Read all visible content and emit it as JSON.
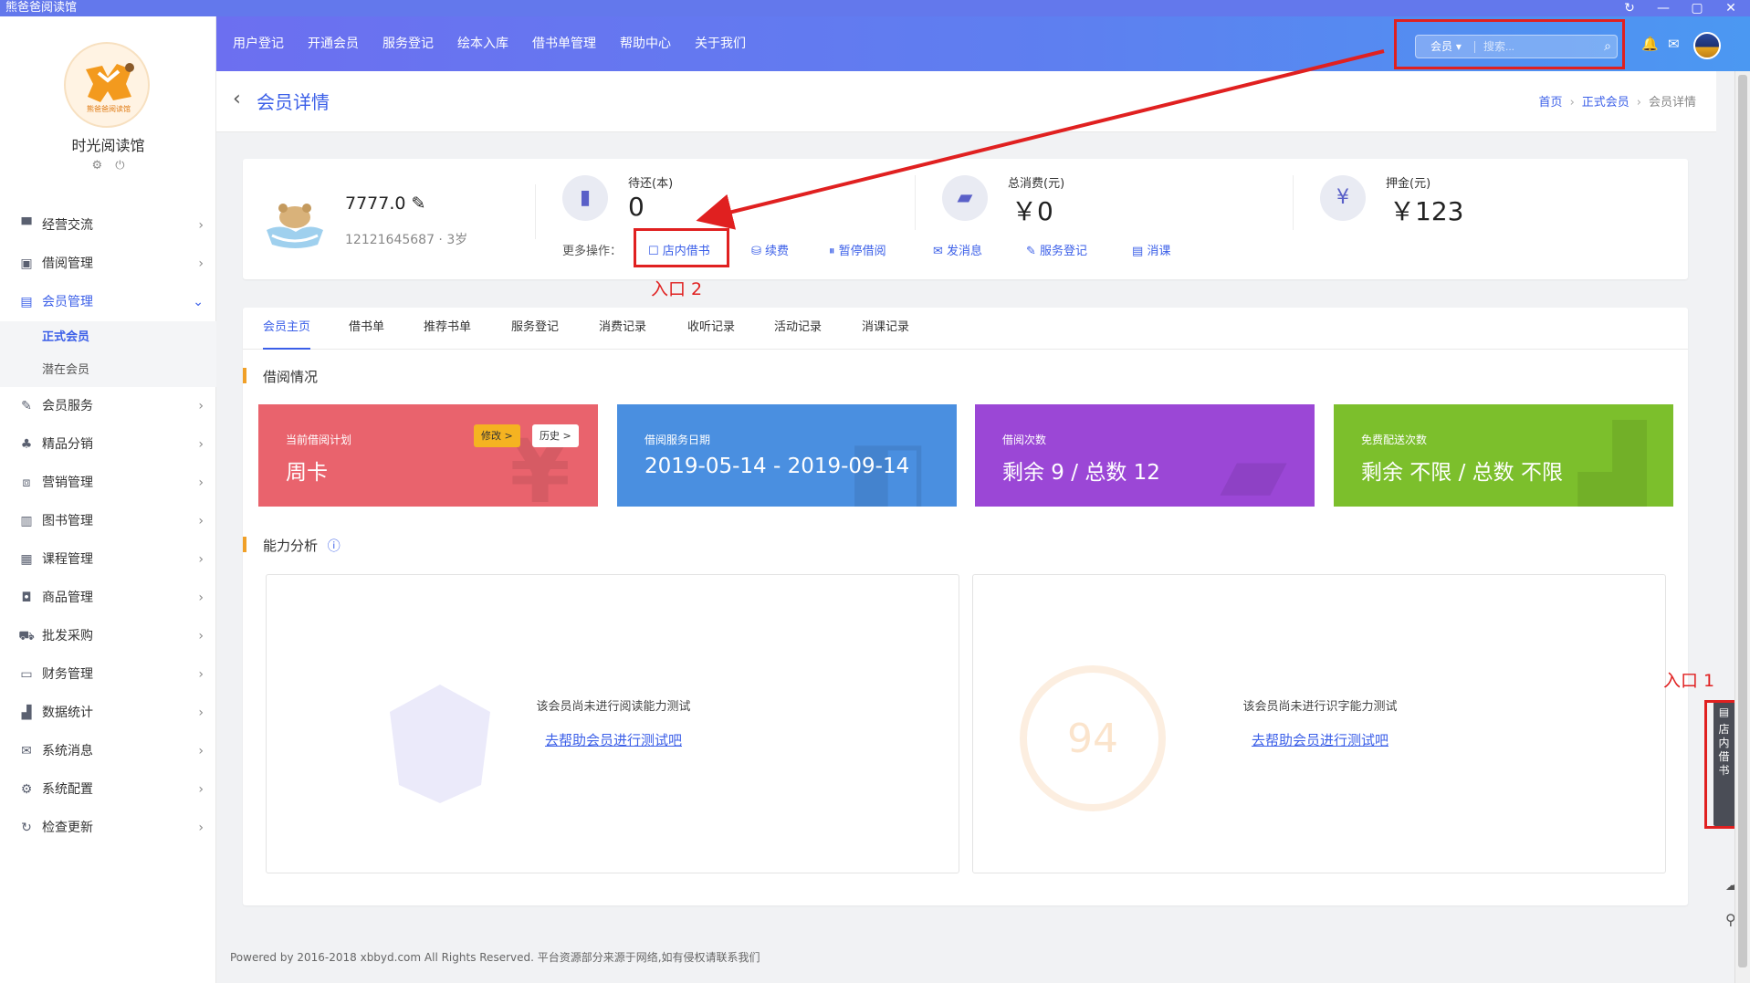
{
  "window": {
    "title": "熊爸爸阅读馆",
    "controls": [
      "↻",
      "—",
      "▢",
      "✕"
    ]
  },
  "sidebar": {
    "logo_text": "熊爸爸阅读馆",
    "shop_name": "时光阅读馆",
    "icons": [
      "gear-icon",
      "power-icon"
    ],
    "menu": [
      {
        "label": "经营交流",
        "icon": "chat-icon"
      },
      {
        "label": "借阅管理",
        "icon": "box-icon"
      },
      {
        "label": "会员管理",
        "icon": "member-icon",
        "active": true,
        "children": [
          {
            "label": "正式会员",
            "active": true
          },
          {
            "label": "潜在会员"
          }
        ]
      },
      {
        "label": "会员服务",
        "icon": "service-icon"
      },
      {
        "label": "精品分销",
        "icon": "network-icon"
      },
      {
        "label": "营销管理",
        "icon": "ticket-icon"
      },
      {
        "label": "图书管理",
        "icon": "book-icon"
      },
      {
        "label": "课程管理",
        "icon": "course-icon"
      },
      {
        "label": "商品管理",
        "icon": "bag-icon"
      },
      {
        "label": "批发采购",
        "icon": "cart-icon"
      },
      {
        "label": "财务管理",
        "icon": "finance-icon"
      },
      {
        "label": "数据统计",
        "icon": "chart-icon"
      },
      {
        "label": "系统消息",
        "icon": "mail-icon"
      },
      {
        "label": "系统配置",
        "icon": "gear-icon"
      },
      {
        "label": "检查更新",
        "icon": "refresh-icon"
      }
    ]
  },
  "topnav": {
    "links": [
      "用户登记",
      "开通会员",
      "服务登记",
      "绘本入库",
      "借书单管理",
      "帮助中心",
      "关于我们"
    ],
    "search_scope": "会员",
    "search_placeholder": "搜索..."
  },
  "header": {
    "title": "会员详情",
    "breadcrumb": [
      "首页",
      "正式会员",
      "会员详情"
    ]
  },
  "member": {
    "name": "7777.0",
    "sub": "12121645687 · 3岁",
    "stats": [
      {
        "label": "待还(本)",
        "value": "0",
        "icon": "book-icon"
      },
      {
        "label": "总消费(元)",
        "value": "￥0",
        "icon": "wallet-icon"
      },
      {
        "label": "押金(元)",
        "value": "￥123",
        "icon": "shield-yen-icon"
      }
    ],
    "ops_label": "更多操作：",
    "ops": [
      {
        "label": "店内借书",
        "icon": "☐"
      },
      {
        "label": "续费",
        "icon": "⛁"
      },
      {
        "label": "暂停借阅",
        "icon": "⏸"
      },
      {
        "label": "发消息",
        "icon": "✉"
      },
      {
        "label": "服务登记",
        "icon": "✎"
      },
      {
        "label": "消课",
        "icon": "▤"
      }
    ],
    "entry2": "入口 2"
  },
  "tabs": [
    "会员主页",
    "借书单",
    "推荐书单",
    "服务登记",
    "消费记录",
    "收听记录",
    "活动记录",
    "消课记录"
  ],
  "borrow_section": {
    "title": "借阅情况",
    "cards": [
      {
        "label": "当前借阅计划",
        "value": "周卡",
        "color": "#e9636d",
        "edit": "修改 >",
        "history": "历史 >"
      },
      {
        "label": "借阅服务日期",
        "value": "2019-05-14 - 2019-09-14",
        "color": "#4a8fe0"
      },
      {
        "label": "借阅次数",
        "value": "剩余 9 / 总数 12",
        "color": "#9b47d6"
      },
      {
        "label": "免费配送次数",
        "value": "剩余 不限 / 总数 不限",
        "color": "#7cbf2c"
      }
    ]
  },
  "ability_section": {
    "title": "能力分析",
    "panels": [
      {
        "message": "该会员尚未进行阅读能力测试",
        "link": "去帮助会员进行测试吧"
      },
      {
        "message": "该会员尚未进行识字能力测试",
        "link": "去帮助会员进行测试吧"
      }
    ]
  },
  "footer": "Powered by 2016-2018 xbbyd.com All Rights Reserved. 平台资源部分来源于网络,如有侵权请联系我们",
  "float": {
    "entry1": "入口 1",
    "button_label": [
      "店",
      "内",
      "借",
      "书"
    ]
  },
  "colors": {
    "accent": "#3b5fe8",
    "annotation": "#e02020"
  }
}
